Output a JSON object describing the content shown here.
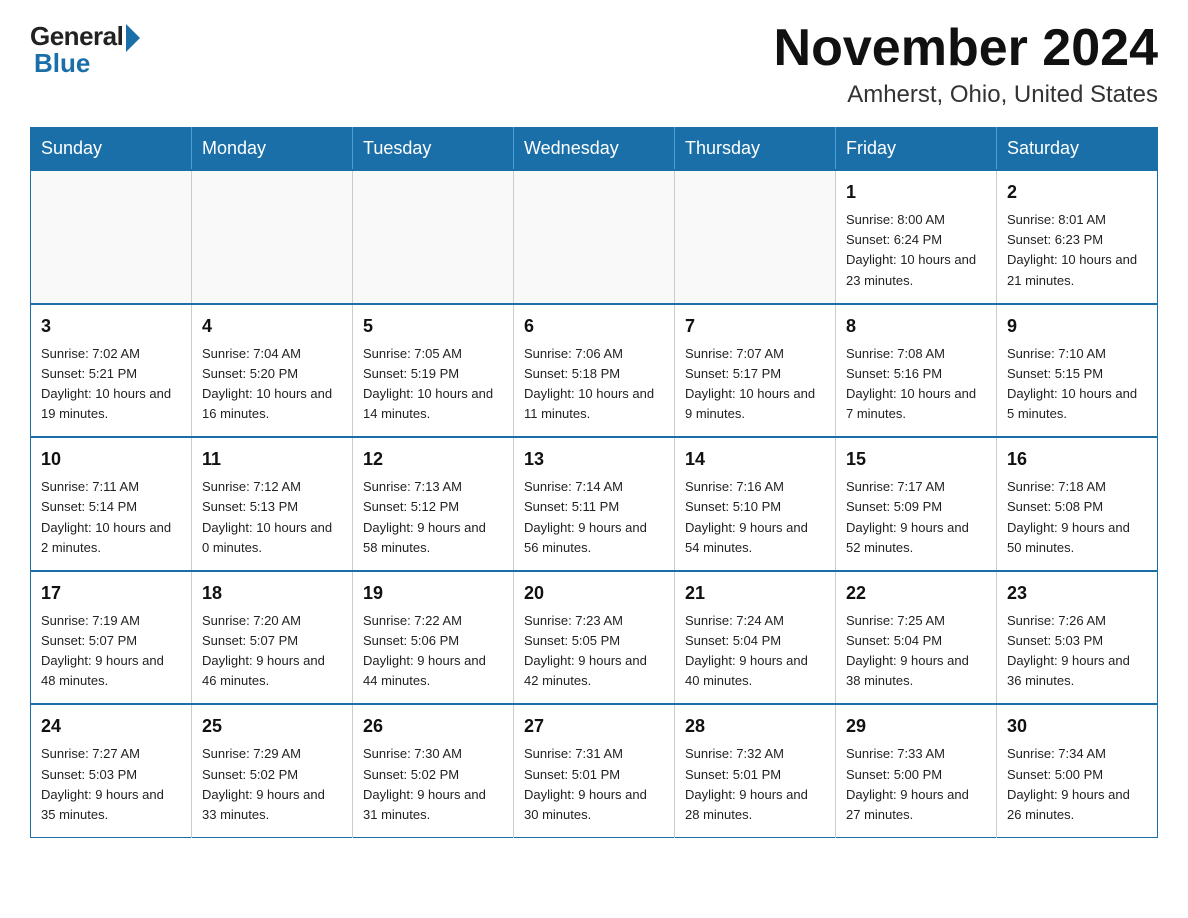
{
  "logo": {
    "general": "General",
    "blue": "Blue"
  },
  "title": "November 2024",
  "subtitle": "Amherst, Ohio, United States",
  "weekdays": [
    "Sunday",
    "Monday",
    "Tuesday",
    "Wednesday",
    "Thursday",
    "Friday",
    "Saturday"
  ],
  "weeks": [
    [
      {
        "day": "",
        "info": ""
      },
      {
        "day": "",
        "info": ""
      },
      {
        "day": "",
        "info": ""
      },
      {
        "day": "",
        "info": ""
      },
      {
        "day": "",
        "info": ""
      },
      {
        "day": "1",
        "info": "Sunrise: 8:00 AM\nSunset: 6:24 PM\nDaylight: 10 hours and 23 minutes."
      },
      {
        "day": "2",
        "info": "Sunrise: 8:01 AM\nSunset: 6:23 PM\nDaylight: 10 hours and 21 minutes."
      }
    ],
    [
      {
        "day": "3",
        "info": "Sunrise: 7:02 AM\nSunset: 5:21 PM\nDaylight: 10 hours and 19 minutes."
      },
      {
        "day": "4",
        "info": "Sunrise: 7:04 AM\nSunset: 5:20 PM\nDaylight: 10 hours and 16 minutes."
      },
      {
        "day": "5",
        "info": "Sunrise: 7:05 AM\nSunset: 5:19 PM\nDaylight: 10 hours and 14 minutes."
      },
      {
        "day": "6",
        "info": "Sunrise: 7:06 AM\nSunset: 5:18 PM\nDaylight: 10 hours and 11 minutes."
      },
      {
        "day": "7",
        "info": "Sunrise: 7:07 AM\nSunset: 5:17 PM\nDaylight: 10 hours and 9 minutes."
      },
      {
        "day": "8",
        "info": "Sunrise: 7:08 AM\nSunset: 5:16 PM\nDaylight: 10 hours and 7 minutes."
      },
      {
        "day": "9",
        "info": "Sunrise: 7:10 AM\nSunset: 5:15 PM\nDaylight: 10 hours and 5 minutes."
      }
    ],
    [
      {
        "day": "10",
        "info": "Sunrise: 7:11 AM\nSunset: 5:14 PM\nDaylight: 10 hours and 2 minutes."
      },
      {
        "day": "11",
        "info": "Sunrise: 7:12 AM\nSunset: 5:13 PM\nDaylight: 10 hours and 0 minutes."
      },
      {
        "day": "12",
        "info": "Sunrise: 7:13 AM\nSunset: 5:12 PM\nDaylight: 9 hours and 58 minutes."
      },
      {
        "day": "13",
        "info": "Sunrise: 7:14 AM\nSunset: 5:11 PM\nDaylight: 9 hours and 56 minutes."
      },
      {
        "day": "14",
        "info": "Sunrise: 7:16 AM\nSunset: 5:10 PM\nDaylight: 9 hours and 54 minutes."
      },
      {
        "day": "15",
        "info": "Sunrise: 7:17 AM\nSunset: 5:09 PM\nDaylight: 9 hours and 52 minutes."
      },
      {
        "day": "16",
        "info": "Sunrise: 7:18 AM\nSunset: 5:08 PM\nDaylight: 9 hours and 50 minutes."
      }
    ],
    [
      {
        "day": "17",
        "info": "Sunrise: 7:19 AM\nSunset: 5:07 PM\nDaylight: 9 hours and 48 minutes."
      },
      {
        "day": "18",
        "info": "Sunrise: 7:20 AM\nSunset: 5:07 PM\nDaylight: 9 hours and 46 minutes."
      },
      {
        "day": "19",
        "info": "Sunrise: 7:22 AM\nSunset: 5:06 PM\nDaylight: 9 hours and 44 minutes."
      },
      {
        "day": "20",
        "info": "Sunrise: 7:23 AM\nSunset: 5:05 PM\nDaylight: 9 hours and 42 minutes."
      },
      {
        "day": "21",
        "info": "Sunrise: 7:24 AM\nSunset: 5:04 PM\nDaylight: 9 hours and 40 minutes."
      },
      {
        "day": "22",
        "info": "Sunrise: 7:25 AM\nSunset: 5:04 PM\nDaylight: 9 hours and 38 minutes."
      },
      {
        "day": "23",
        "info": "Sunrise: 7:26 AM\nSunset: 5:03 PM\nDaylight: 9 hours and 36 minutes."
      }
    ],
    [
      {
        "day": "24",
        "info": "Sunrise: 7:27 AM\nSunset: 5:03 PM\nDaylight: 9 hours and 35 minutes."
      },
      {
        "day": "25",
        "info": "Sunrise: 7:29 AM\nSunset: 5:02 PM\nDaylight: 9 hours and 33 minutes."
      },
      {
        "day": "26",
        "info": "Sunrise: 7:30 AM\nSunset: 5:02 PM\nDaylight: 9 hours and 31 minutes."
      },
      {
        "day": "27",
        "info": "Sunrise: 7:31 AM\nSunset: 5:01 PM\nDaylight: 9 hours and 30 minutes."
      },
      {
        "day": "28",
        "info": "Sunrise: 7:32 AM\nSunset: 5:01 PM\nDaylight: 9 hours and 28 minutes."
      },
      {
        "day": "29",
        "info": "Sunrise: 7:33 AM\nSunset: 5:00 PM\nDaylight: 9 hours and 27 minutes."
      },
      {
        "day": "30",
        "info": "Sunrise: 7:34 AM\nSunset: 5:00 PM\nDaylight: 9 hours and 26 minutes."
      }
    ]
  ],
  "colors": {
    "header_bg": "#1a6fa8",
    "header_text": "#ffffff",
    "border": "#1a6fa8"
  }
}
